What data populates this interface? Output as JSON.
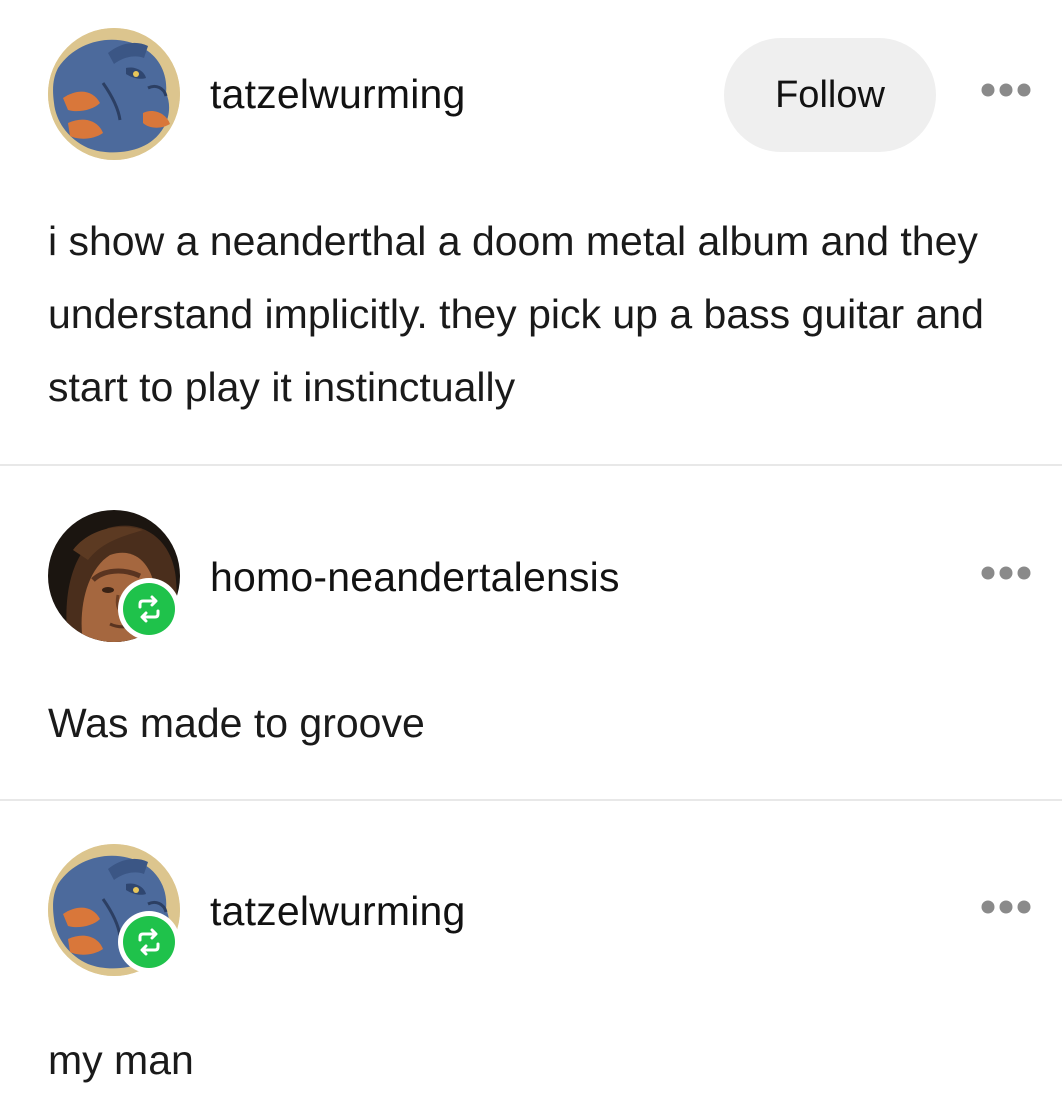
{
  "posts": [
    {
      "username": "tatzelwurming",
      "follow_label": "Follow",
      "more_icon": "ellipsis-icon",
      "avatar_icon": "dragon-avatar",
      "text": "i show a neanderthal a doom metal album and they understand implicitly. they pick up a bass guitar and start to play it instinctually"
    },
    {
      "username": "homo-neandertalensis",
      "more_icon": "ellipsis-icon",
      "avatar_icon": "neanderthal-portrait-avatar",
      "badge_icon": "reblog-icon",
      "text": "Was made to groove"
    },
    {
      "username": "tatzelwurming",
      "more_icon": "ellipsis-icon",
      "avatar_icon": "dragon-avatar",
      "badge_icon": "reblog-icon",
      "text": "my man"
    }
  ],
  "colors": {
    "reblog_green": "#1fc24b",
    "follow_bg": "#efefef",
    "divider": "#e8e8e8",
    "text": "#121212",
    "more_dots": "#8a8a8a"
  }
}
